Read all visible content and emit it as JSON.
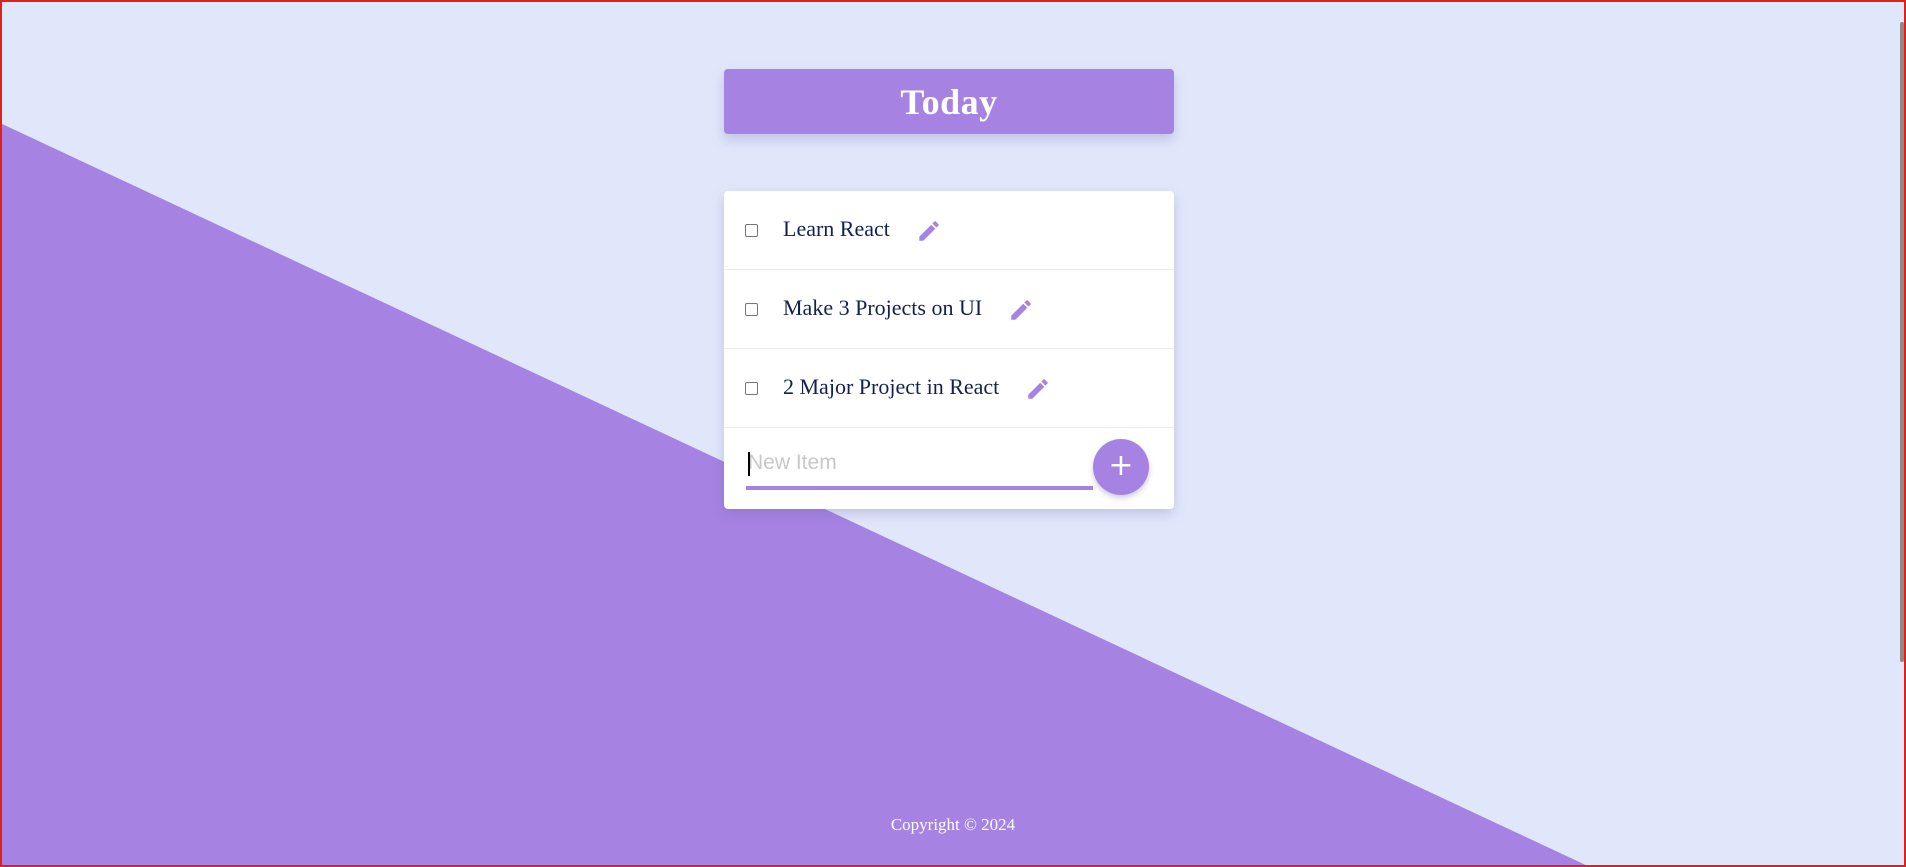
{
  "colors": {
    "background": "#e1e7fb",
    "accent": "#a683e3",
    "text": "#142050",
    "frame": "#e0201a"
  },
  "header": {
    "title": "Today"
  },
  "todo": {
    "items": [
      {
        "label": "Learn React",
        "checked": false,
        "edit_icon": "pencil-icon"
      },
      {
        "label": "Make 3 Projects on UI",
        "checked": false,
        "edit_icon": "pencil-icon"
      },
      {
        "label": "2 Major Project in React",
        "checked": false,
        "edit_icon": "pencil-icon"
      }
    ],
    "new_item": {
      "placeholder": "New Item",
      "value": ""
    },
    "add_button": {
      "label": "+",
      "icon": "plus-icon"
    }
  },
  "footer": {
    "copyright": "Copyright © 2024"
  }
}
